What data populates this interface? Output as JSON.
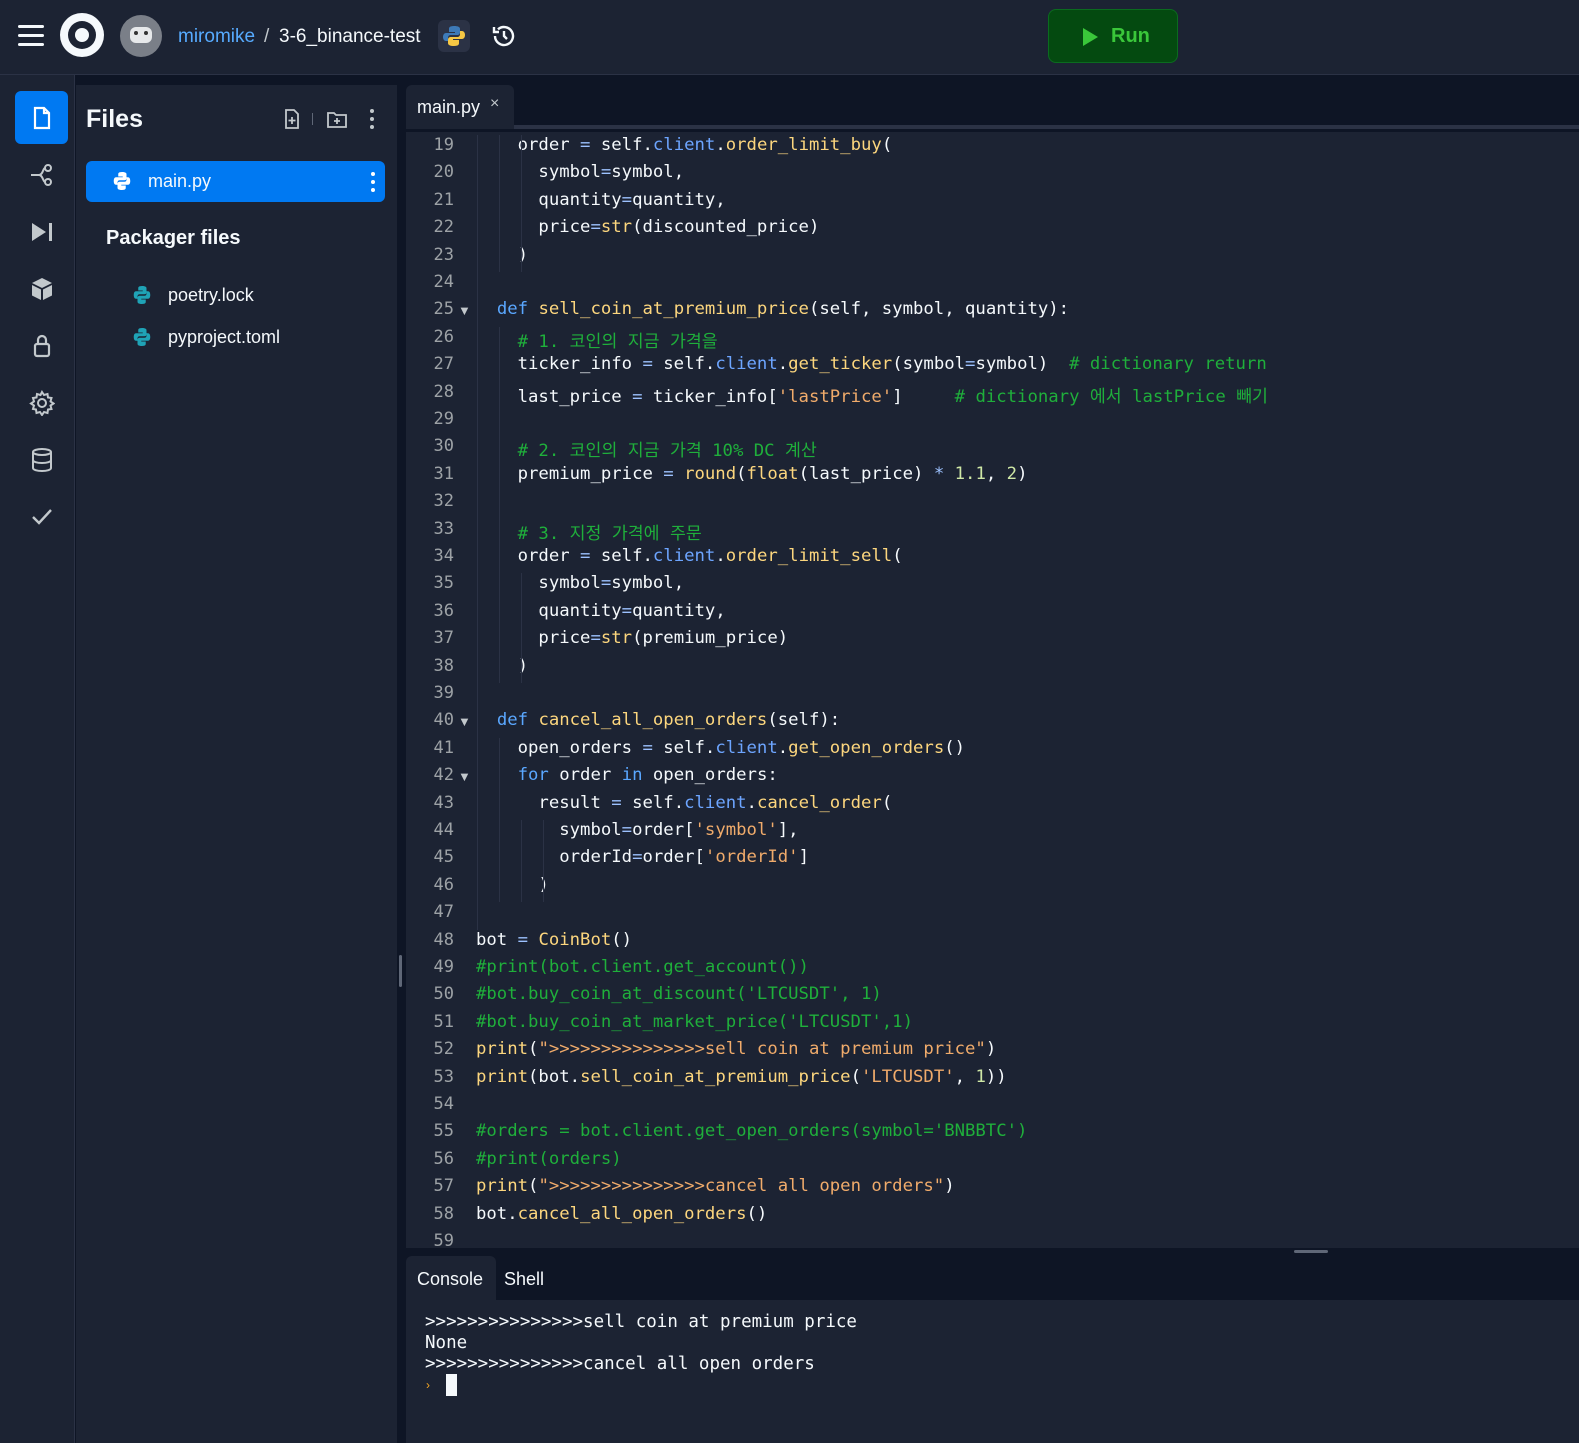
{
  "topbar": {
    "username": "miromike",
    "separator": "/",
    "repl_name": "3-6_binance-test",
    "run_label": "Run",
    "language_icon": "python-icon",
    "history_icon": "history-icon"
  },
  "rail": {
    "items": [
      "files-icon",
      "git-icon",
      "debugger-icon",
      "packages-icon",
      "secrets-icon",
      "settings-icon",
      "database-icon",
      "check-icon"
    ]
  },
  "files": {
    "title": "Files",
    "active_file": "main.py",
    "packager_title": "Packager files",
    "packager_items": [
      "poetry.lock",
      "pyproject.toml"
    ]
  },
  "editor": {
    "tab": "main.py",
    "tab_close": "×",
    "lines": [
      {
        "n": "19",
        "code": "    order = self.client.order_limit_buy("
      },
      {
        "n": "20",
        "code": "      symbol=symbol,"
      },
      {
        "n": "21",
        "code": "      quantity=quantity,"
      },
      {
        "n": "22",
        "code": "      price=str(discounted_price)"
      },
      {
        "n": "23",
        "code": "    )"
      },
      {
        "n": "24",
        "code": ""
      },
      {
        "n": "25",
        "code": "  def sell_coin_at_premium_price(self, symbol, quantity):"
      },
      {
        "n": "26",
        "code": "    # 1. 코인의 지금 가격을"
      },
      {
        "n": "27",
        "code": "    ticker_info = self.client.get_ticker(symbol=symbol)  # dictionary return"
      },
      {
        "n": "28",
        "code": "    last_price = ticker_info['lastPrice']     # dictionary 에서 lastPrice 빼기"
      },
      {
        "n": "29",
        "code": ""
      },
      {
        "n": "30",
        "code": "    # 2. 코인의 지금 가격 10% DC 계산"
      },
      {
        "n": "31",
        "code": "    premium_price = round(float(last_price) * 1.1, 2)"
      },
      {
        "n": "32",
        "code": ""
      },
      {
        "n": "33",
        "code": "    # 3. 지정 가격에 주문"
      },
      {
        "n": "34",
        "code": "    order = self.client.order_limit_sell("
      },
      {
        "n": "35",
        "code": "      symbol=symbol,"
      },
      {
        "n": "36",
        "code": "      quantity=quantity,"
      },
      {
        "n": "37",
        "code": "      price=str(premium_price)"
      },
      {
        "n": "38",
        "code": "    )"
      },
      {
        "n": "39",
        "code": ""
      },
      {
        "n": "40",
        "code": "  def cancel_all_open_orders(self):"
      },
      {
        "n": "41",
        "code": "    open_orders = self.client.get_open_orders()"
      },
      {
        "n": "42",
        "code": "    for order in open_orders:"
      },
      {
        "n": "43",
        "code": "      result = self.client.cancel_order("
      },
      {
        "n": "44",
        "code": "        symbol=order['symbol'],"
      },
      {
        "n": "45",
        "code": "        orderId=order['orderId']"
      },
      {
        "n": "46",
        "code": "      )"
      },
      {
        "n": "47",
        "code": ""
      },
      {
        "n": "48",
        "code": "bot = CoinBot()"
      },
      {
        "n": "49",
        "code": "#print(bot.client.get_account())"
      },
      {
        "n": "50",
        "code": "#bot.buy_coin_at_discount('LTCUSDT', 1)"
      },
      {
        "n": "51",
        "code": "#bot.buy_coin_at_market_price('LTCUSDT',1)"
      },
      {
        "n": "52",
        "code": "print(\">>>>>>>>>>>>>>>sell coin at premium price\")"
      },
      {
        "n": "53",
        "code": "print(bot.sell_coin_at_premium_price('LTCUSDT', 1))"
      },
      {
        "n": "54",
        "code": ""
      },
      {
        "n": "55",
        "code": "#orders = bot.client.get_open_orders(symbol='BNBBTC')"
      },
      {
        "n": "56",
        "code": "#print(orders)"
      },
      {
        "n": "57",
        "code": "print(\">>>>>>>>>>>>>>>cancel all open orders\")"
      },
      {
        "n": "58",
        "code": "bot.cancel_all_open_orders()"
      },
      {
        "n": "59",
        "code": ""
      }
    ],
    "fold_lines": [
      "25",
      "40",
      "42"
    ],
    "fold_glyph": "▼"
  },
  "console": {
    "tabs": [
      "Console",
      "Shell"
    ],
    "output": [
      ">>>>>>>>>>>>>>>sell coin at premium price",
      "None",
      ">>>>>>>>>>>>>>>cancel all open orders"
    ],
    "prompt": "›"
  },
  "colors": {
    "accent": "#0079f2",
    "run": "#3ac73a",
    "background": "#1c2333"
  }
}
